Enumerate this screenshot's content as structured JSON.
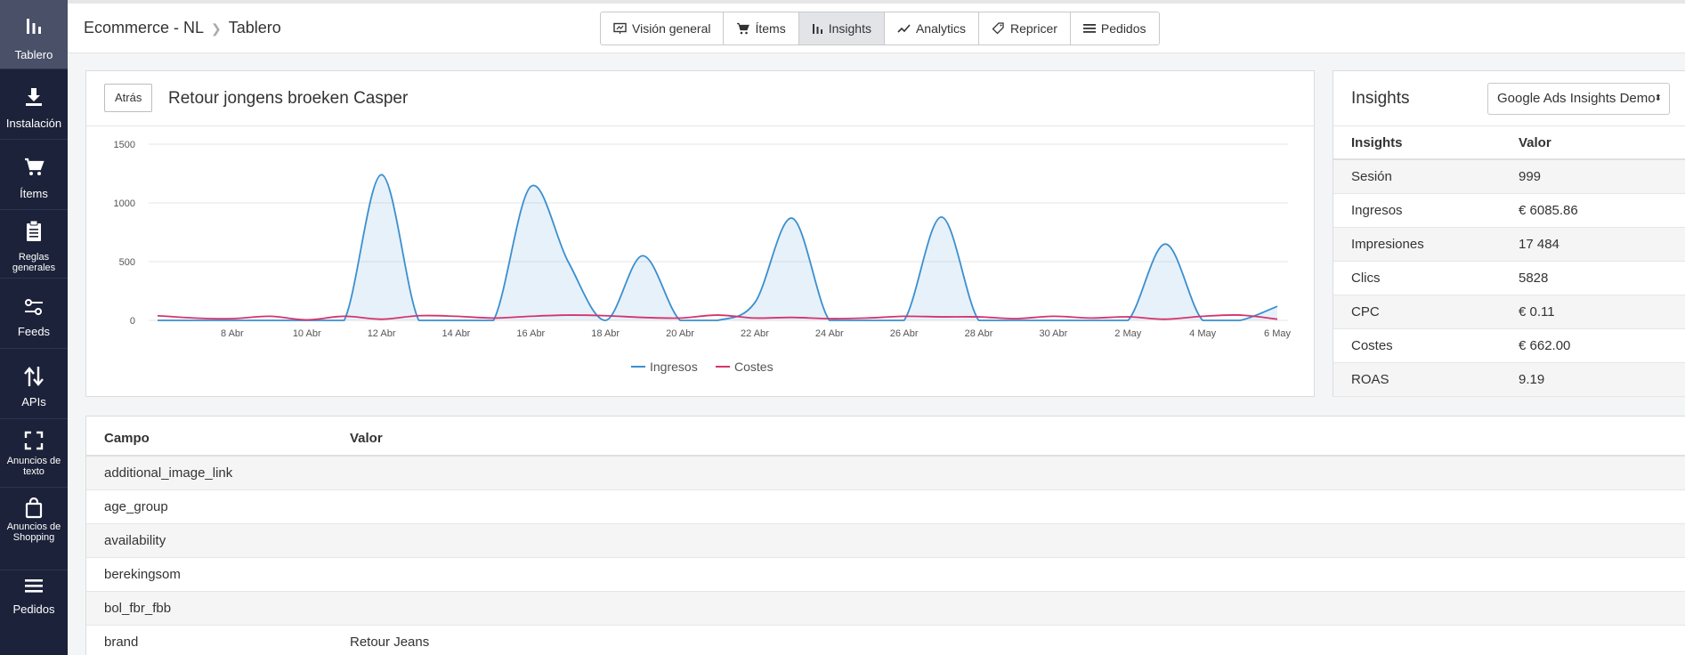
{
  "sidebar": {
    "items": [
      {
        "label": "Tablero",
        "icon": "bar-chart-icon",
        "active": true
      },
      {
        "label": "Instalación",
        "icon": "download-icon"
      },
      {
        "label": "Ítems",
        "icon": "cart-icon"
      },
      {
        "label": "Reglas generales",
        "icon": "clipboard-icon"
      },
      {
        "label": "Feeds",
        "icon": "sliders-icon"
      },
      {
        "label": "APIs",
        "icon": "arrows-updown-icon"
      },
      {
        "label": "Anuncios de texto",
        "icon": "expand-icon"
      },
      {
        "label": "Anuncios de Shopping",
        "icon": "shopping-bag-icon"
      },
      {
        "label": "Pedidos",
        "icon": "list-icon"
      }
    ]
  },
  "breadcrumb": {
    "root": "Ecommerce - NL",
    "current": "Tablero"
  },
  "nav": {
    "tabs": [
      {
        "label": "Visión general",
        "icon": "presentation-icon"
      },
      {
        "label": "Ítems",
        "icon": "cart-icon"
      },
      {
        "label": "Insights",
        "icon": "bar-chart-icon",
        "active": true
      },
      {
        "label": "Analytics",
        "icon": "trend-line-icon"
      },
      {
        "label": "Repricer",
        "icon": "tag-icon"
      },
      {
        "label": "Pedidos",
        "icon": "list-icon"
      }
    ]
  },
  "chart_panel": {
    "back_label": "Atrás",
    "title": "Retour jongens broeken Casper"
  },
  "chart_data": {
    "type": "line",
    "x": [
      "6 Abr",
      "7 Abr",
      "8 Abr",
      "9 Abr",
      "10 Abr",
      "11 Abr",
      "12 Abr",
      "13 Abr",
      "14 Abr",
      "15 Abr",
      "16 Abr",
      "17 Abr",
      "18 Abr",
      "19 Abr",
      "20 Abr",
      "21 Abr",
      "22 Abr",
      "23 Abr",
      "24 Abr",
      "25 Abr",
      "26 Abr",
      "27 Abr",
      "28 Abr",
      "29 Abr",
      "30 Abr",
      "1 May",
      "2 May",
      "3 May",
      "4 May",
      "5 May",
      "6 May"
    ],
    "x_tick_labels": [
      "8 Abr",
      "10 Abr",
      "12 Abr",
      "14 Abr",
      "16 Abr",
      "18 Abr",
      "20 Abr",
      "22 Abr",
      "24 Abr",
      "26 Abr",
      "28 Abr",
      "30 Abr",
      "2 May",
      "4 May",
      "6 May"
    ],
    "series": [
      {
        "name": "Ingresos",
        "color": "#3a8fcf",
        "values": [
          0,
          0,
          0,
          0,
          0,
          0,
          1240,
          0,
          0,
          0,
          1140,
          500,
          0,
          550,
          0,
          0,
          150,
          870,
          0,
          0,
          0,
          880,
          0,
          0,
          0,
          0,
          0,
          650,
          0,
          0,
          120
        ]
      },
      {
        "name": "Costes",
        "color": "#d6336c",
        "values": [
          40,
          20,
          15,
          35,
          5,
          35,
          10,
          40,
          35,
          20,
          35,
          45,
          40,
          25,
          20,
          45,
          20,
          25,
          15,
          20,
          35,
          30,
          30,
          15,
          35,
          20,
          30,
          10,
          35,
          45,
          10
        ]
      }
    ],
    "y_ticks": [
      0,
      500,
      1000,
      1500
    ],
    "ylim": [
      0,
      1500
    ],
    "grid": true,
    "legend_position": "bottom-center"
  },
  "insights": {
    "title": "Insights",
    "select_value": "Google Ads Insights Demo",
    "columns": [
      "Insights",
      "Valor"
    ],
    "rows": [
      {
        "k": "Sesión",
        "v": "999"
      },
      {
        "k": "Ingresos",
        "v": "€ 6085.86"
      },
      {
        "k": "Impresiones",
        "v": "17 484"
      },
      {
        "k": "Clics",
        "v": "5828"
      },
      {
        "k": "CPC",
        "v": "€ 0.11"
      },
      {
        "k": "Costes",
        "v": "€ 662.00"
      },
      {
        "k": "ROAS",
        "v": "9.19"
      }
    ]
  },
  "fields": {
    "columns": [
      "Campo",
      "Valor"
    ],
    "rows": [
      {
        "k": "additional_image_link",
        "v": ""
      },
      {
        "k": "age_group",
        "v": ""
      },
      {
        "k": "availability",
        "v": ""
      },
      {
        "k": "berekingsom",
        "v": ""
      },
      {
        "k": "bol_fbr_fbb",
        "v": ""
      },
      {
        "k": "brand",
        "v": "Retour Jeans"
      }
    ]
  }
}
